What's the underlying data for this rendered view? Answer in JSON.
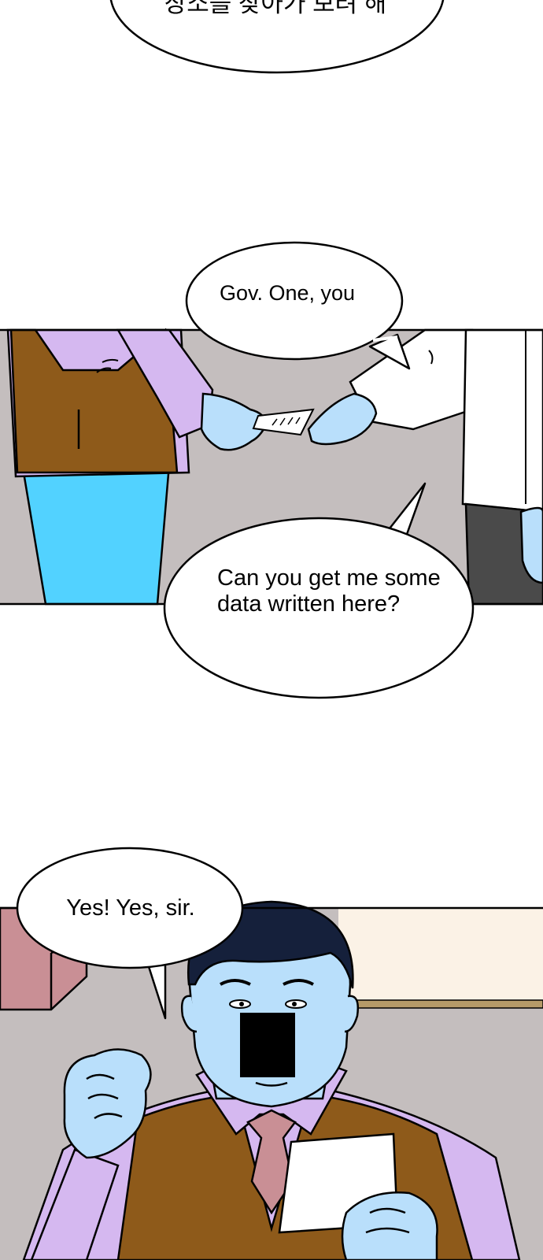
{
  "bubbles": {
    "top_korean": "장소를 찾아가 보려 해",
    "gov_one": "Gov. One, you",
    "can_you": "Can you get me some data written here?",
    "yes_sir": "Yes! Yes, sir."
  },
  "colors": {
    "wall_gray": "#c4bebe",
    "sweater_purple": "#d5b8f0",
    "vest_brown": "#8e5a1a",
    "pants_cyan": "#52d2ff",
    "skin_blue": "#b9dffb",
    "hair_navy": "#15203b",
    "suit_dark": "#4a4a4a",
    "tie_pink": "#c98f95",
    "cabinet_pink": "#c98f95",
    "wall_cream": "#fbf2e6",
    "rail_tan": "#b59a68",
    "censor_black": "#000000"
  }
}
